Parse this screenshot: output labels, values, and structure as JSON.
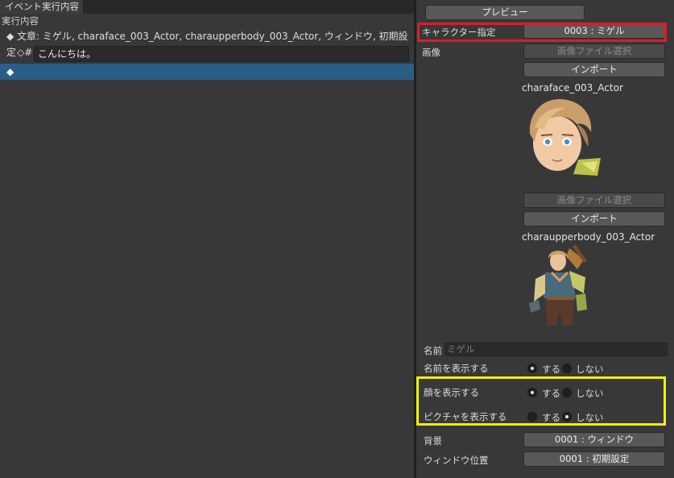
{
  "left": {
    "tab_label": "イベント実行内容",
    "section_label": "実行内容",
    "rows": {
      "text_command": "◆ 文章: ミゲル, charaface_003_Actor, charaupperbody_003_Actor, ウィンドウ, 初期設定",
      "text_prefix": "◇#",
      "text_value": "こんにちは。",
      "empty_command": "◆"
    }
  },
  "right": {
    "preview_button": "プレビュー",
    "character_label": "キャラクター指定",
    "character_value": "0003 : ミゲル",
    "image_label": "画像",
    "select_image_button": "画像ファイル選択",
    "import_button": "インポート",
    "face_asset": "charaface_003_Actor",
    "select_image_button_2": "画像ファイル選択",
    "import_button_2": "インポート",
    "body_asset": "charaupperbody_003_Actor",
    "name_label": "名前",
    "name_placeholder": "ミゲル",
    "show_name_label": "名前を表示する",
    "show_face_label": "顔を表示する",
    "show_picture_label": "ピクチャを表示する",
    "yes_label": "する",
    "no_label": "しない",
    "options": {
      "show_name": "する",
      "show_face": "する",
      "show_picture": "しない"
    },
    "background_label": "背景",
    "background_value": "0001 : ウィンドウ",
    "window_pos_label": "ウィンドウ位置",
    "window_pos_value": "0001 : 初期設定"
  },
  "colors": {
    "panel_bg": "#383838",
    "selection": "#2c5d87",
    "highlight_red": "#e01b24",
    "highlight_yellow": "#f3ef00"
  }
}
